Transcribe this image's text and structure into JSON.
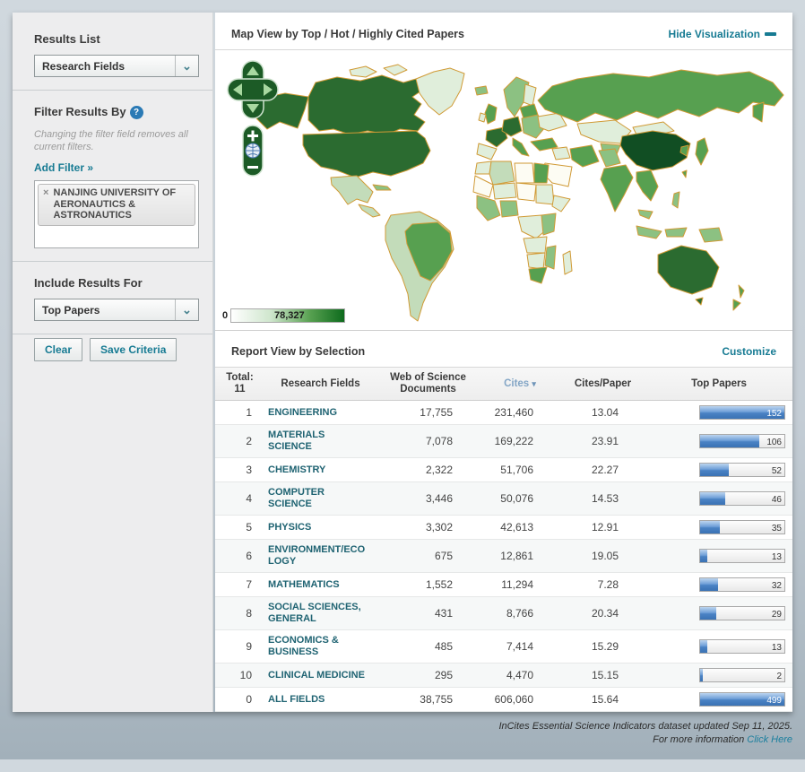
{
  "colors": {
    "link_teal": "#177b93",
    "field_link": "#1f6372",
    "bar_blue": "#4a82c4",
    "map_dark_green": "#2b6b30",
    "legend_max_green": "#0d6b1d",
    "page_background": "#c4cdd5"
  },
  "icons": {
    "dropdown_chevron": "⌄",
    "help": "?",
    "remove_filter": "×",
    "sort_desc": "▾"
  },
  "sidebar": {
    "results_list": {
      "label": "Results List",
      "dropdown_value": "Research Fields"
    },
    "filter": {
      "label": "Filter Results By",
      "note": "Changing the filter field removes all current filters.",
      "add_filter_label": "Add Filter »",
      "selected_filter": "NANJING UNIVERSITY OF AERONAUTICS & ASTRONAUTICS"
    },
    "include": {
      "label": "Include Results For",
      "dropdown_value": "Top Papers"
    },
    "buttons": {
      "clear": "Clear",
      "save": "Save Criteria"
    }
  },
  "map_section": {
    "title": "Map View by Top / Hot / Highly Cited Papers",
    "hide_link": "Hide Visualization",
    "legend": {
      "min": "0",
      "max": "78,327"
    }
  },
  "report": {
    "title": "Report View by Selection",
    "customize_link": "Customize",
    "table": {
      "total_label": "Total:",
      "total_value": "11",
      "columns": [
        "Research Fields",
        "Web of Science Documents",
        "Cites",
        "Cites/Paper",
        "Top Papers"
      ],
      "sorted_column": "Cites",
      "rows": [
        {
          "rank": "1",
          "field": "ENGINEERING",
          "docs": "17,755",
          "cites": "231,460",
          "cites_per_paper": "13.04",
          "top_papers": "152",
          "bar_pct": 100
        },
        {
          "rank": "2",
          "field": "MATERIALS SCIENCE",
          "docs": "7,078",
          "cites": "169,222",
          "cites_per_paper": "23.91",
          "top_papers": "106",
          "bar_pct": 70
        },
        {
          "rank": "3",
          "field": "CHEMISTRY",
          "docs": "2,322",
          "cites": "51,706",
          "cites_per_paper": "22.27",
          "top_papers": "52",
          "bar_pct": 34
        },
        {
          "rank": "4",
          "field": "COMPUTER SCIENCE",
          "docs": "3,446",
          "cites": "50,076",
          "cites_per_paper": "14.53",
          "top_papers": "46",
          "bar_pct": 30
        },
        {
          "rank": "5",
          "field": "PHYSICS",
          "docs": "3,302",
          "cites": "42,613",
          "cites_per_paper": "12.91",
          "top_papers": "35",
          "bar_pct": 23
        },
        {
          "rank": "6",
          "field": "ENVIRONMENT/ECOLOGY",
          "docs": "675",
          "cites": "12,861",
          "cites_per_paper": "19.05",
          "top_papers": "13",
          "bar_pct": 9
        },
        {
          "rank": "7",
          "field": "MATHEMATICS",
          "docs": "1,552",
          "cites": "11,294",
          "cites_per_paper": "7.28",
          "top_papers": "32",
          "bar_pct": 21
        },
        {
          "rank": "8",
          "field": "SOCIAL SCIENCES, GENERAL",
          "docs": "431",
          "cites": "8,766",
          "cites_per_paper": "20.34",
          "top_papers": "29",
          "bar_pct": 19
        },
        {
          "rank": "9",
          "field": "ECONOMICS & BUSINESS",
          "docs": "485",
          "cites": "7,414",
          "cites_per_paper": "15.29",
          "top_papers": "13",
          "bar_pct": 9
        },
        {
          "rank": "10",
          "field": "CLINICAL MEDICINE",
          "docs": "295",
          "cites": "4,470",
          "cites_per_paper": "15.15",
          "top_papers": "2",
          "bar_pct": 3
        },
        {
          "rank": "0",
          "field": "ALL FIELDS",
          "docs": "38,755",
          "cites": "606,060",
          "cites_per_paper": "15.64",
          "top_papers": "499",
          "bar_pct": 100
        }
      ]
    }
  },
  "footer": {
    "line1": "InCites Essential Science Indicators dataset updated Sep 11, 2025.",
    "line2": "For more information",
    "link": "Click Here"
  }
}
